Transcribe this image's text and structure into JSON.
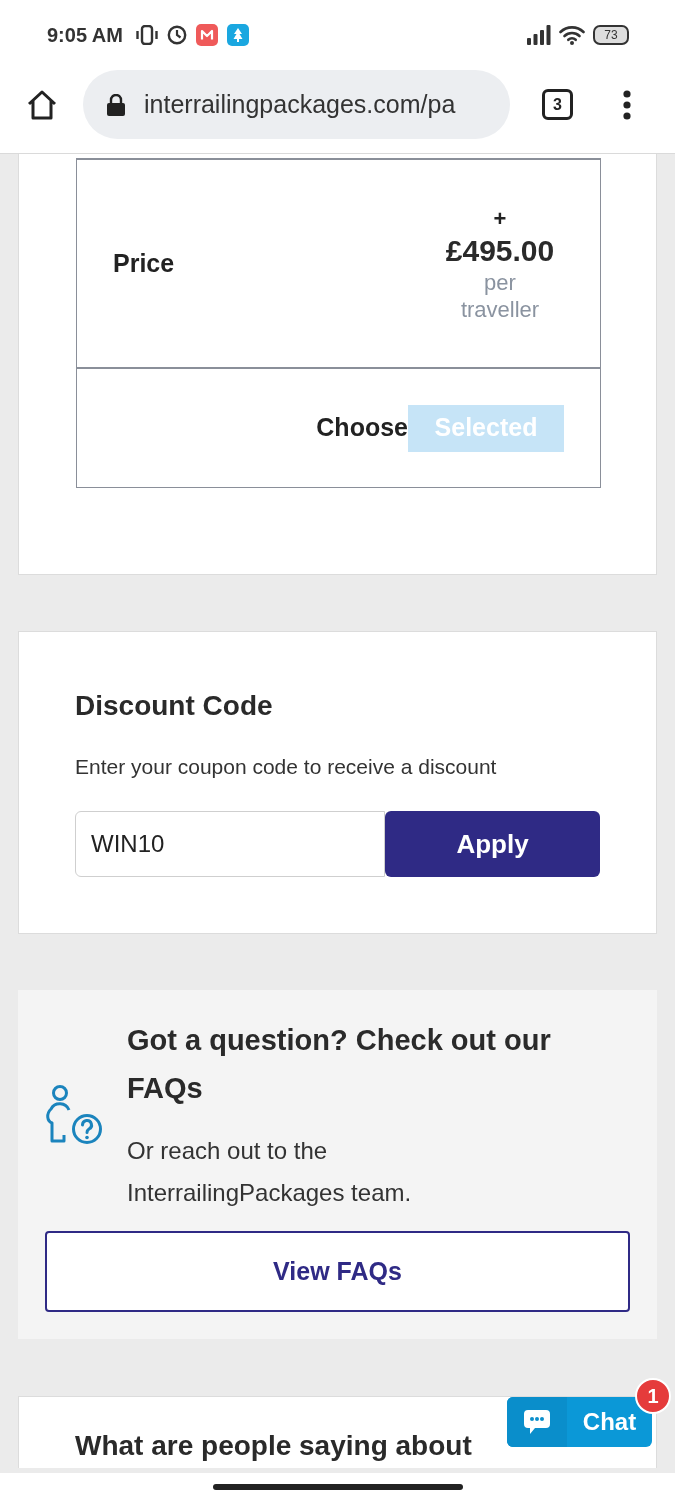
{
  "status_bar": {
    "time": "9:05 AM",
    "battery": "73"
  },
  "browser": {
    "url": "interrailingpackages.com/pa",
    "tab_count": "3"
  },
  "package_table": {
    "price_label": "Price",
    "price_prefix": "+",
    "price": "£495.00",
    "price_unit": "per traveller",
    "choose_label": "Choose",
    "choose_button": {
      "label": "Selected",
      "selected": true
    }
  },
  "discount": {
    "title": "Discount Code",
    "description": "Enter your coupon code to receive a discount",
    "code_field": {
      "value": "WIN10"
    },
    "apply_button": "Apply"
  },
  "faq": {
    "title": "Got a question? Check out our FAQs",
    "text": "Or reach out to the InterrailingPackages team.",
    "button": "View FAQs"
  },
  "reviews": {
    "title": "What are people saying about"
  },
  "chat": {
    "label": "Chat",
    "badge": "1"
  }
}
